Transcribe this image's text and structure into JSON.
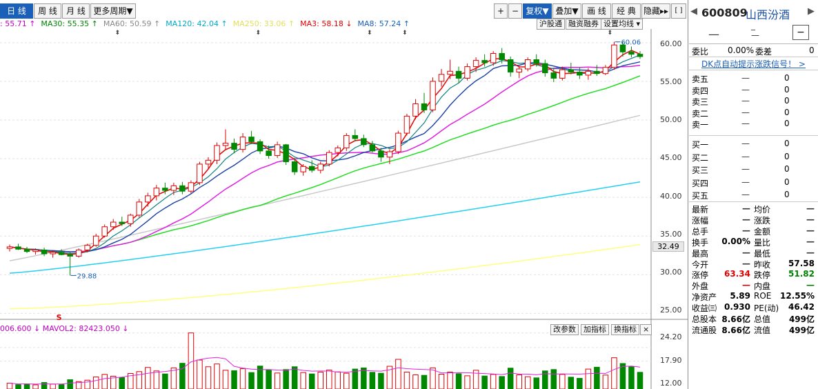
{
  "toolbar": {
    "periods": [
      "日 线",
      "周 线",
      "月 线",
      "更多周期▼"
    ],
    "right": [
      "+",
      "−",
      "复权▼",
      "叠加▼",
      "画 线",
      "经 典",
      "隐藏▸▸",
      "[ ]"
    ]
  },
  "ma_legend": {
    "items": [
      {
        "label": ": 55.71 ↑",
        "color": "#c000c0"
      },
      {
        "label": "MA30: 55.35 ↑",
        "color": "#008000"
      },
      {
        "label": "MA60: 50.59 ↑",
        "color": "#888888"
      },
      {
        "label": "MA120: 42.04 ↑",
        "color": "#00a8c8"
      },
      {
        "label": "MA250: 33.06 ↑",
        "color": "#e0e060"
      },
      {
        "label": "MA3: 58.18 ↓",
        "color": "#e00000"
      },
      {
        "label": "MA8: 57.24 ↑",
        "color": "#1a5fb8"
      }
    ]
  },
  "chart_buttons": {
    "hgt": "沪股通",
    "margin": "融资融券",
    "ma_setting": "设置均线 ▾"
  },
  "price_axis": [
    "60.00",
    "55.00",
    "50.00",
    "45.00",
    "40.00",
    "35.00",
    "30.00",
    "25.00"
  ],
  "current_price": "32.49",
  "annotations": {
    "high": "60.06",
    "low": "29.88",
    "marker": "S"
  },
  "volume": {
    "legend": "006.600 ↓  MAVOL2: 82423.050 ↓",
    "buttons": [
      "改参数",
      "加指标",
      "换指标",
      "×"
    ],
    "axis": [
      "24.20",
      "17.90",
      "12.00"
    ]
  },
  "chart_data": {
    "type": "candlestick",
    "ylim": [
      24.5,
      61.5
    ],
    "ohlc": [
      [
        33.4,
        33.9,
        33.0,
        33.6
      ],
      [
        33.6,
        34.0,
        33.2,
        33.3
      ],
      [
        33.3,
        33.6,
        32.8,
        33.0
      ],
      [
        33.0,
        33.4,
        32.6,
        33.2
      ],
      [
        33.2,
        33.5,
        32.4,
        32.7
      ],
      [
        32.7,
        33.1,
        32.2,
        32.9
      ],
      [
        32.9,
        33.3,
        32.5,
        32.6
      ],
      [
        32.6,
        32.9,
        29.9,
        32.4
      ],
      [
        32.4,
        33.4,
        32.2,
        33.2
      ],
      [
        33.2,
        34.0,
        32.9,
        33.8
      ],
      [
        33.8,
        35.3,
        33.6,
        35.0
      ],
      [
        35.0,
        36.5,
        34.8,
        36.2
      ],
      [
        36.2,
        37.2,
        35.8,
        36.8
      ],
      [
        36.8,
        37.5,
        36.3,
        36.6
      ],
      [
        36.6,
        37.9,
        36.2,
        37.7
      ],
      [
        37.7,
        39.8,
        37.4,
        39.4
      ],
      [
        39.4,
        40.6,
        38.8,
        40.2
      ],
      [
        40.2,
        41.6,
        39.6,
        41.2
      ],
      [
        41.2,
        41.9,
        40.4,
        40.9
      ],
      [
        40.9,
        41.9,
        40.3,
        41.5
      ],
      [
        41.5,
        42.0,
        40.4,
        40.8
      ],
      [
        40.8,
        42.2,
        40.5,
        41.9
      ],
      [
        41.9,
        44.6,
        41.6,
        44.3
      ],
      [
        44.3,
        45.2,
        43.6,
        44.8
      ],
      [
        44.8,
        47.1,
        44.3,
        46.7
      ],
      [
        46.7,
        48.8,
        46.1,
        47.0
      ],
      [
        47.0,
        47.6,
        45.7,
        46.2
      ],
      [
        46.2,
        48.3,
        45.8,
        47.8
      ],
      [
        47.8,
        48.6,
        46.9,
        47.2
      ],
      [
        47.2,
        47.5,
        45.6,
        46.0
      ],
      [
        46.0,
        46.7,
        45.0,
        45.4
      ],
      [
        45.4,
        47.2,
        45.1,
        46.8
      ],
      [
        46.8,
        46.9,
        44.2,
        44.6
      ],
      [
        44.6,
        45.1,
        42.9,
        43.3
      ],
      [
        43.3,
        44.3,
        42.8,
        44.0
      ],
      [
        44.0,
        44.8,
        43.2,
        43.5
      ],
      [
        43.5,
        44.6,
        43.1,
        44.3
      ],
      [
        44.3,
        46.1,
        44.0,
        45.8
      ],
      [
        45.8,
        46.7,
        45.3,
        46.4
      ],
      [
        46.4,
        48.3,
        46.0,
        48.0
      ],
      [
        48.0,
        48.8,
        47.3,
        47.6
      ],
      [
        47.6,
        48.1,
        46.5,
        46.8
      ],
      [
        46.8,
        47.3,
        45.8,
        46.0
      ],
      [
        46.0,
        46.4,
        44.6,
        45.2
      ],
      [
        45.2,
        46.2,
        44.3,
        45.9
      ],
      [
        45.9,
        48.6,
        45.6,
        48.3
      ],
      [
        48.3,
        50.8,
        48.0,
        50.5
      ],
      [
        50.5,
        52.7,
        50.1,
        52.1
      ],
      [
        52.1,
        53.5,
        50.9,
        51.3
      ],
      [
        51.3,
        55.5,
        51.0,
        55.0
      ],
      [
        55.0,
        56.6,
        54.3,
        55.9
      ],
      [
        55.9,
        57.8,
        55.3,
        56.3
      ],
      [
        56.3,
        56.9,
        54.8,
        55.4
      ],
      [
        55.4,
        57.3,
        55.1,
        56.9
      ],
      [
        56.9,
        58.1,
        56.2,
        57.7
      ],
      [
        57.7,
        58.5,
        56.9,
        57.4
      ],
      [
        57.4,
        58.9,
        57.0,
        58.6
      ],
      [
        58.6,
        59.3,
        57.3,
        57.8
      ],
      [
        57.8,
        58.2,
        55.6,
        56.2
      ],
      [
        56.2,
        57.0,
        55.4,
        56.6
      ],
      [
        56.6,
        58.1,
        56.3,
        57.8
      ],
      [
        57.8,
        58.5,
        56.9,
        57.3
      ],
      [
        57.3,
        57.8,
        55.6,
        56.1
      ],
      [
        56.1,
        56.6,
        54.9,
        55.4
      ],
      [
        55.4,
        56.9,
        55.1,
        56.5
      ],
      [
        56.5,
        57.4,
        55.9,
        56.2
      ],
      [
        56.2,
        56.8,
        55.3,
        55.8
      ],
      [
        55.8,
        56.7,
        55.2,
        56.3
      ],
      [
        56.3,
        57.1,
        55.7,
        56.0
      ],
      [
        56.0,
        57.1,
        55.8,
        56.8
      ],
      [
        56.8,
        60.1,
        56.5,
        59.7
      ],
      [
        59.7,
        60.1,
        58.2,
        58.8
      ],
      [
        58.8,
        59.5,
        58.1,
        58.5
      ],
      [
        58.5,
        58.9,
        57.9,
        58.2
      ]
    ],
    "volume": [
      2.5,
      1.9,
      2.2,
      1.8,
      2.8,
      2.1,
      1.9,
      4.0,
      3.2,
      3.8,
      5.2,
      6.3,
      5.5,
      4.9,
      6.7,
      7.5,
      9.3,
      7.8,
      6.5,
      9.1,
      11.1,
      24.2,
      12.5,
      9.6,
      10.8,
      8.1,
      7.9,
      8.8,
      7.1,
      9.9,
      8.2,
      6.9,
      8.4,
      9.6,
      7.1,
      6.5,
      7.3,
      8.2,
      7.4,
      6.8,
      8.6,
      9.1,
      7.2,
      6.8,
      9.8,
      12.8,
      7.3,
      6.1,
      5.9,
      9.1,
      6.4,
      7.3,
      6.6,
      5.7,
      8.1,
      5.6,
      6.3,
      5.4,
      9.0,
      6.1,
      5.3,
      4.8,
      7.8,
      8.4,
      6.3,
      5.1,
      4.6,
      8.6,
      9.4,
      6.0,
      13.5,
      11.0,
      9.6,
      7.2
    ]
  },
  "quote": {
    "code": "600809",
    "name": "山西汾酒",
    "dashes": [
      "—",
      "_",
      "—"
    ],
    "weibi_label": "委比",
    "weibi": "0.00%",
    "weicha_label": "委差",
    "weicha": "0",
    "signal": "DK点自动提示涨跌信号！ >",
    "sells": [
      {
        "l": "卖五",
        "p": "—",
        "v": "0"
      },
      {
        "l": "卖四",
        "p": "—",
        "v": "0"
      },
      {
        "l": "卖三",
        "p": "—",
        "v": "0"
      },
      {
        "l": "卖二",
        "p": "—",
        "v": "0"
      },
      {
        "l": "卖一",
        "p": "—",
        "v": "0"
      }
    ],
    "buys": [
      {
        "l": "买一",
        "p": "—",
        "v": "0"
      },
      {
        "l": "买二",
        "p": "—",
        "v": "0"
      },
      {
        "l": "买三",
        "p": "—",
        "v": "0"
      },
      {
        "l": "买四",
        "p": "—",
        "v": "0"
      },
      {
        "l": "买五",
        "p": "—",
        "v": "0"
      }
    ],
    "stats": [
      {
        "l1": "最新",
        "v1": "—",
        "l2": "均价",
        "v2": "—",
        "c1": "#333",
        "c2": "#333"
      },
      {
        "l1": "涨幅",
        "v1": "—",
        "l2": "涨跌",
        "v2": "—",
        "c1": "#333",
        "c2": "#333"
      },
      {
        "l1": "总手",
        "v1": "—",
        "l2": "金额",
        "v2": "—",
        "c1": "#333",
        "c2": "#333"
      },
      {
        "l1": "换手",
        "v1": "0.00%",
        "l2": "量比",
        "v2": "—",
        "c1": "#000",
        "c2": "#333"
      },
      {
        "l1": "最高",
        "v1": "—",
        "l2": "最低",
        "v2": "—",
        "c1": "#333",
        "c2": "#333"
      },
      {
        "l1": "今开",
        "v1": "—",
        "l2": "昨收",
        "v2": "57.58",
        "c1": "#333",
        "c2": "#000"
      },
      {
        "l1": "涨停",
        "v1": "63.34",
        "l2": "跌停",
        "v2": "51.82",
        "c1": "#e00000",
        "c2": "#008000"
      },
      {
        "l1": "外盘",
        "v1": "—",
        "l2": "内盘",
        "v2": "—",
        "c1": "#e00000",
        "c2": "#008000"
      },
      {
        "l1": "净资产",
        "v1": "5.89",
        "l2": "ROE",
        "v2": "12.55%",
        "c1": "#000",
        "c2": "#000"
      },
      {
        "l1": "收益㈢",
        "v1": "0.930",
        "l2": "PE(动)",
        "v2": "46.42",
        "c1": "#000",
        "c2": "#000"
      },
      {
        "l1": "总股本",
        "v1": "8.66亿",
        "l2": "总值",
        "v2": "499亿",
        "c1": "#000",
        "c2": "#000"
      },
      {
        "l1": "流通股",
        "v1": "8.66亿",
        "l2": "流值",
        "v2": "499亿",
        "c1": "#000",
        "c2": "#000"
      }
    ]
  }
}
